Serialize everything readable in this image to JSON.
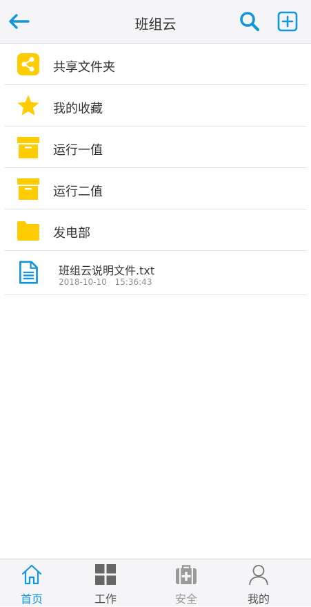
{
  "header": {
    "title": "班组云"
  },
  "folders": [
    {
      "label": "共享文件夹",
      "icon": "share-folder-icon"
    },
    {
      "label": "我的收藏",
      "icon": "star-icon"
    },
    {
      "label": "运行一值",
      "icon": "archive-box-icon"
    },
    {
      "label": "运行二值",
      "icon": "archive-box-icon"
    },
    {
      "label": "发电部",
      "icon": "folder-icon"
    }
  ],
  "files": [
    {
      "name": "班组云说明文件.txt",
      "date": "2018-10-10 15:36:43",
      "icon": "document-icon"
    }
  ],
  "tabs": [
    {
      "label": "首页",
      "icon": "home-icon",
      "active": true
    },
    {
      "label": "工作",
      "icon": "grid-icon"
    },
    {
      "label": "安全",
      "icon": "first-aid-kit-icon"
    },
    {
      "label": "我的",
      "icon": "user-icon"
    }
  ],
  "colors": {
    "accent": "#1296db",
    "folder_yellow": "#ffcc00",
    "header_bg": "#f5f5f7"
  }
}
